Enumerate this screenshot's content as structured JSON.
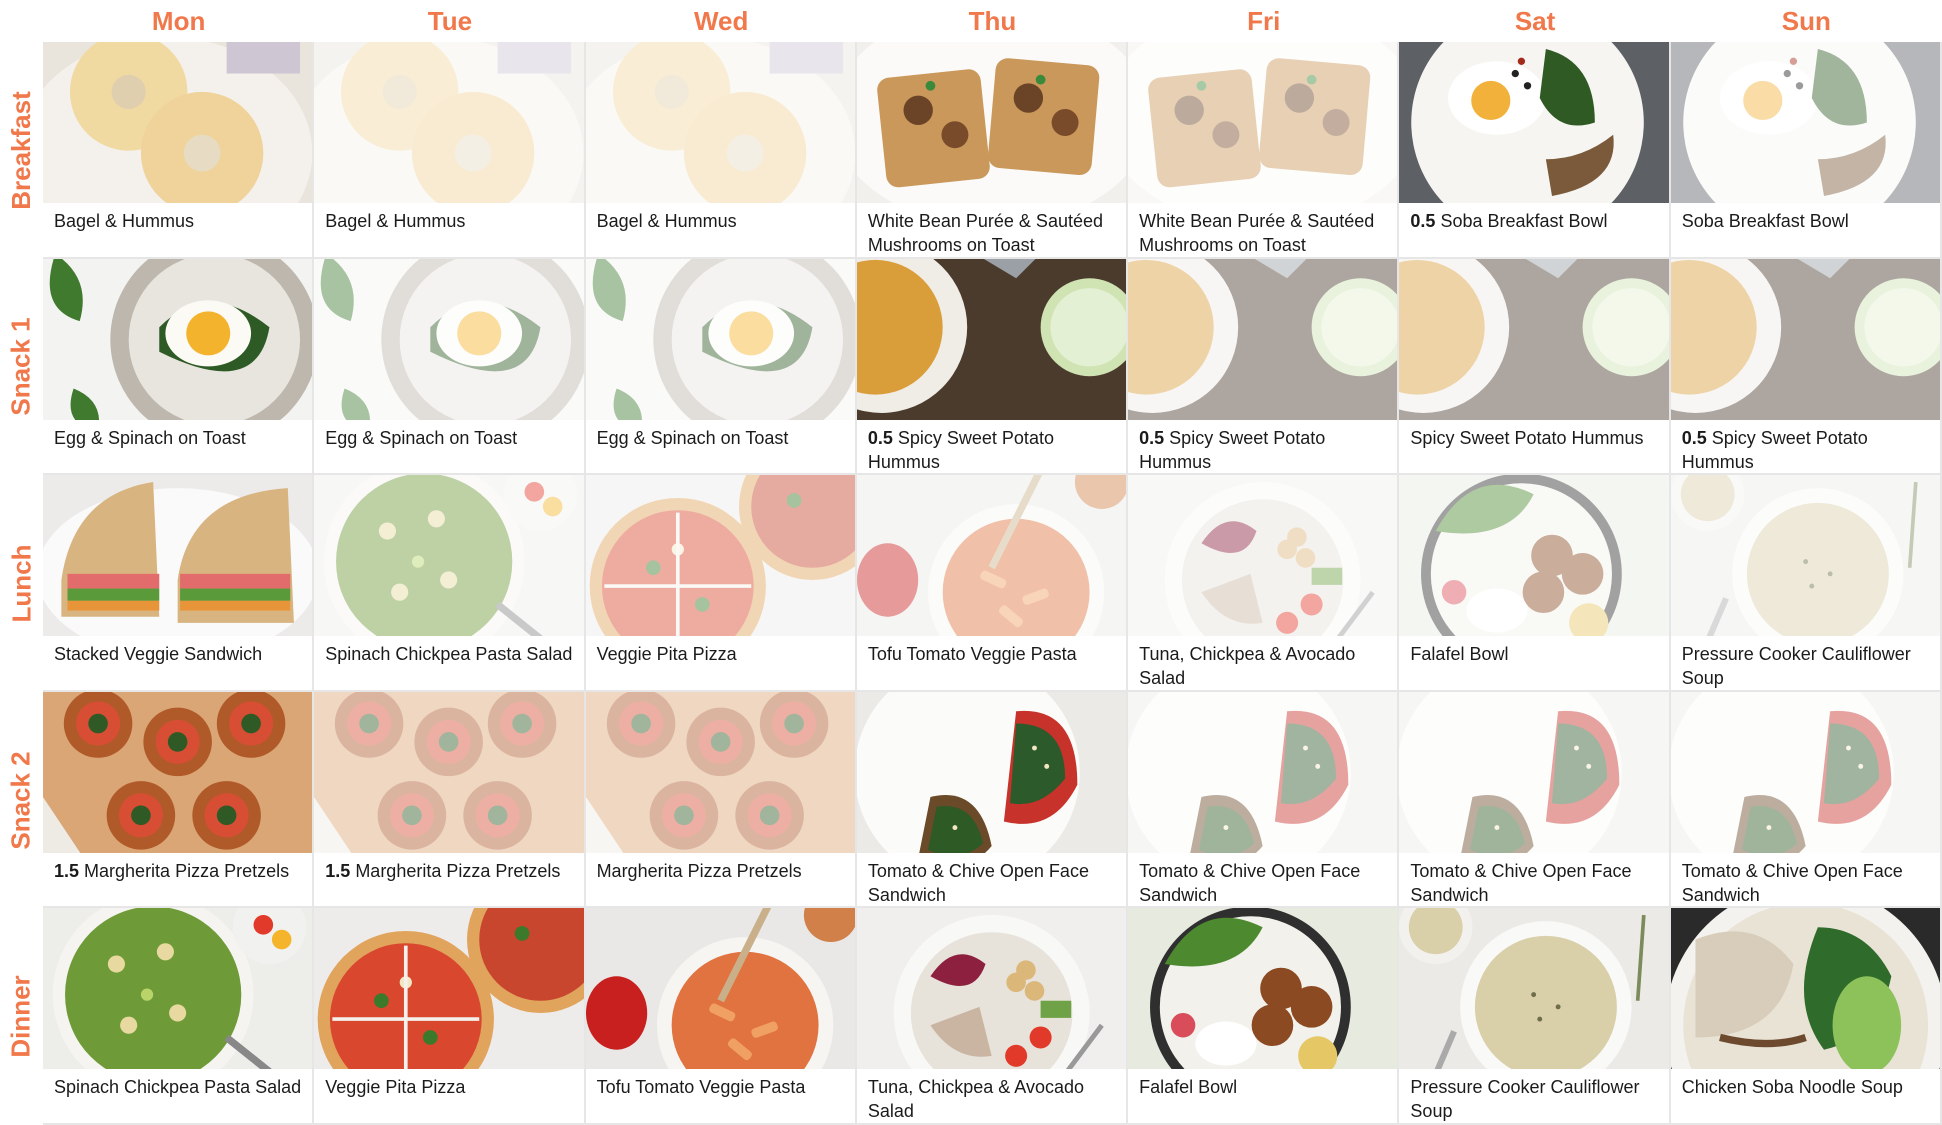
{
  "days": [
    "Mon",
    "Tue",
    "Wed",
    "Thu",
    "Fri",
    "Sat",
    "Sun"
  ],
  "meals": [
    {
      "label": "Breakfast",
      "cells": [
        {
          "qty": "",
          "name": "Bagel & Hummus",
          "faded": false,
          "photo": "bagel"
        },
        {
          "qty": "",
          "name": "Bagel & Hummus",
          "faded": true,
          "photo": "bagel"
        },
        {
          "qty": "",
          "name": "Bagel & Hummus",
          "faded": true,
          "photo": "bagel"
        },
        {
          "qty": "",
          "name": "White Bean Purée & Sautéed Mushrooms on Toast",
          "faded": false,
          "photo": "toast"
        },
        {
          "qty": "",
          "name": "White Bean Purée & Sautéed Mushrooms on Toast",
          "faded": true,
          "photo": "toast"
        },
        {
          "qty": "0.5",
          "name": "Soba Breakfast Bowl",
          "faded": false,
          "photo": "soba"
        },
        {
          "qty": "",
          "name": "Soba Breakfast Bowl",
          "faded": true,
          "photo": "soba"
        }
      ]
    },
    {
      "label": "Snack 1",
      "cells": [
        {
          "qty": "",
          "name": "Egg & Spinach on Toast",
          "faded": false,
          "photo": "egg"
        },
        {
          "qty": "",
          "name": "Egg & Spinach on Toast",
          "faded": true,
          "photo": "egg"
        },
        {
          "qty": "",
          "name": "Egg & Spinach on Toast",
          "faded": true,
          "photo": "egg"
        },
        {
          "qty": "0.5",
          "name": "Spicy Sweet Potato Hummus",
          "faded": false,
          "photo": "hummus"
        },
        {
          "qty": "0.5",
          "name": "Spicy Sweet Potato Hummus",
          "faded": true,
          "photo": "hummus"
        },
        {
          "qty": "",
          "name": "Spicy Sweet Potato Hummus",
          "faded": true,
          "photo": "hummus"
        },
        {
          "qty": "0.5",
          "name": "Spicy Sweet Potato Hummus",
          "faded": true,
          "photo": "hummus"
        }
      ]
    },
    {
      "label": "Lunch",
      "cells": [
        {
          "qty": "",
          "name": "Stacked Veggie Sandwich",
          "faded": false,
          "photo": "sandwich"
        },
        {
          "qty": "",
          "name": "Spinach Chickpea Pasta Salad",
          "faded": true,
          "photo": "pastasalad"
        },
        {
          "qty": "",
          "name": "Veggie Pita Pizza",
          "faded": true,
          "photo": "pizza"
        },
        {
          "qty": "",
          "name": "Tofu Tomato Veggie Pasta",
          "faded": true,
          "photo": "pasta"
        },
        {
          "qty": "",
          "name": "Tuna, Chickpea & Avocado Salad",
          "faded": true,
          "photo": "tuna"
        },
        {
          "qty": "",
          "name": "Falafel Bowl",
          "faded": true,
          "photo": "falafel"
        },
        {
          "qty": "",
          "name": "Pressure Cooker Cauliflower Soup",
          "faded": true,
          "photo": "soup"
        }
      ]
    },
    {
      "label": "Snack 2",
      "cells": [
        {
          "qty": "1.5",
          "name": "Margherita Pizza Pretzels",
          "faded": false,
          "photo": "pretzel"
        },
        {
          "qty": "1.5",
          "name": "Margherita Pizza Pretzels",
          "faded": true,
          "photo": "pretzel"
        },
        {
          "qty": "",
          "name": "Margherita Pizza Pretzels",
          "faded": true,
          "photo": "pretzel"
        },
        {
          "qty": "",
          "name": "Tomato & Chive Open Face Sandwich",
          "faded": false,
          "photo": "tomatotoast"
        },
        {
          "qty": "",
          "name": "Tomato & Chive Open Face Sandwich",
          "faded": true,
          "photo": "tomatotoast"
        },
        {
          "qty": "",
          "name": "Tomato & Chive Open Face Sandwich",
          "faded": true,
          "photo": "tomatotoast"
        },
        {
          "qty": "",
          "name": "Tomato & Chive Open Face Sandwich",
          "faded": true,
          "photo": "tomatotoast"
        }
      ]
    },
    {
      "label": "Dinner",
      "cells": [
        {
          "qty": "",
          "name": "Spinach Chickpea Pasta Salad",
          "faded": false,
          "photo": "pastasalad"
        },
        {
          "qty": "",
          "name": "Veggie Pita Pizza",
          "faded": false,
          "photo": "pizza"
        },
        {
          "qty": "",
          "name": "Tofu Tomato Veggie Pasta",
          "faded": false,
          "photo": "pasta"
        },
        {
          "qty": "",
          "name": "Tuna, Chickpea & Avocado Salad",
          "faded": false,
          "photo": "tuna"
        },
        {
          "qty": "",
          "name": "Falafel Bowl",
          "faded": false,
          "photo": "falafel"
        },
        {
          "qty": "",
          "name": "Pressure Cooker Cauliflower Soup",
          "faded": false,
          "photo": "soup"
        },
        {
          "qty": "",
          "name": "Chicken Soba Noodle Soup",
          "faded": false,
          "photo": "chickensoba"
        }
      ]
    }
  ],
  "colors": {
    "accent": "#f0784a",
    "text": "#1b1b1b",
    "border": "#e6e6e6"
  }
}
